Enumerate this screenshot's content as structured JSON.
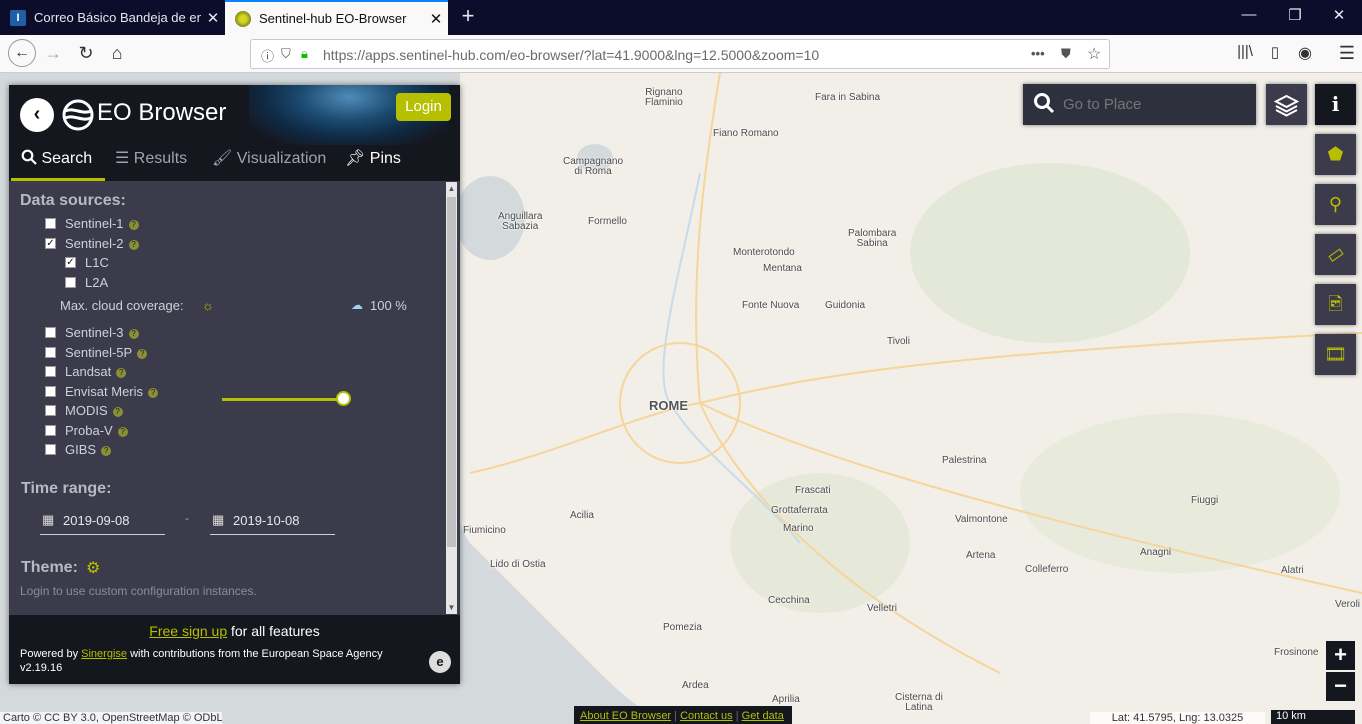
{
  "browser": {
    "tabs": [
      {
        "title": "Correo Básico Bandeja de entra"
      },
      {
        "title": "Sentinel-hub EO-Browser"
      }
    ],
    "url": "https://apps.sentinel-hub.com/eo-browser/?lat=41.9000&lng=12.5000&zoom=10"
  },
  "panel": {
    "brand": "EO Browser",
    "login_label": "Login",
    "tabs": [
      {
        "label": "Search"
      },
      {
        "label": "Results"
      },
      {
        "label": "Visualization"
      },
      {
        "label": "Pins"
      }
    ],
    "data_sources_title": "Data sources:",
    "sources": [
      {
        "label": "Sentinel-1",
        "checked": false
      },
      {
        "label": "Sentinel-2",
        "checked": true
      },
      {
        "label": "L1C",
        "checked": true
      },
      {
        "label": "L2A",
        "checked": false
      },
      {
        "label": "Sentinel-3",
        "checked": false
      },
      {
        "label": "Sentinel-5P",
        "checked": false
      },
      {
        "label": "Landsat",
        "checked": false
      },
      {
        "label": "Envisat Meris",
        "checked": false
      },
      {
        "label": "MODIS",
        "checked": false
      },
      {
        "label": "Proba-V",
        "checked": false
      },
      {
        "label": "GIBS",
        "checked": false
      }
    ],
    "cloud_coverage_label": "Max. cloud coverage:",
    "cloud_coverage_value": "100 %",
    "cloud_coverage_fraction": 1.0,
    "time_range_title": "Time range:",
    "date_from": "2019-09-08",
    "date_sep": "-",
    "date_to": "2019-10-08",
    "theme_title": "Theme:",
    "theme_hint": "Login to use custom configuration instances.",
    "footer": {
      "signup_link": "Free sign up",
      "signup_rest": "for all features",
      "powered_prefix": "Powered by",
      "powered_link": "Sinergise",
      "powered_rest": "with contributions from the European Space Agency",
      "version": "v2.19.16"
    }
  },
  "map": {
    "search_placeholder": "Go to Place",
    "labels": [
      {
        "text": "Rignano\nFlaminio"
      },
      {
        "text": "Fara in Sabina"
      },
      {
        "text": "Fiano Romano"
      },
      {
        "text": "Campagnano\ndi Roma"
      },
      {
        "text": "Anguillara\nSabazia"
      },
      {
        "text": "Formello"
      },
      {
        "text": "Palombara\nSabina"
      },
      {
        "text": "Monterotondo"
      },
      {
        "text": "Mentana"
      },
      {
        "text": "Fonte Nuova"
      },
      {
        "text": "Guidonia"
      },
      {
        "text": "Tivoli"
      },
      {
        "text": "ROME"
      },
      {
        "text": "Palestrina"
      },
      {
        "text": "Frascati"
      },
      {
        "text": "Grottaferrata"
      },
      {
        "text": "Marino"
      },
      {
        "text": "Fiuggi"
      },
      {
        "text": "Valmontone"
      },
      {
        "text": "Fiumicino"
      },
      {
        "text": "Acilia"
      },
      {
        "text": "Artena"
      },
      {
        "text": "Anagni"
      },
      {
        "text": "Lido di Ostia"
      },
      {
        "text": "Colleferro"
      },
      {
        "text": "Alatri"
      },
      {
        "text": "Cecchina"
      },
      {
        "text": "Velletri"
      },
      {
        "text": "Veroli"
      },
      {
        "text": "Pomezia"
      },
      {
        "text": "Frosinone"
      },
      {
        "text": "Ardea"
      },
      {
        "text": "Aprilia"
      },
      {
        "text": "Cisterna di\nLatina"
      }
    ],
    "zoom_in": "+",
    "zoom_out": "−",
    "attribution": "Carto © CC BY 3.0, OpenStreetMap © ODbL",
    "links": [
      "About EO Browser",
      "Contact us",
      "Get data"
    ],
    "coords": "Lat: 41.5795, Lng: 13.0325",
    "scale": "10 km"
  },
  "colors": {
    "accent": "#b6bf00",
    "panel_bg": "#3b3b4b",
    "header_bg": "#15171f"
  }
}
